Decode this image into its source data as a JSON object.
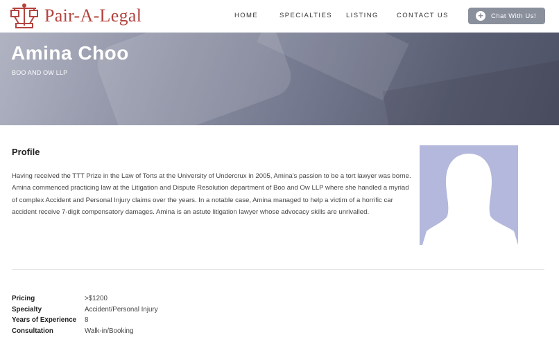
{
  "header": {
    "logo_text": "Pair-A-Legal",
    "brand_color": "#b5433f",
    "nav": [
      {
        "label": "HOME"
      },
      {
        "label": "SPECIALTIES"
      },
      {
        "label": "LISTING"
      },
      {
        "label": "CONTACT US"
      }
    ],
    "chat_button": {
      "label": "Chat With Us!",
      "icon": "plus-circle-icon",
      "color": "#8a8f9c"
    }
  },
  "hero": {
    "name": "Amina Choo",
    "firm": "BOO AND OW LLP"
  },
  "profile": {
    "heading": "Profile",
    "body": "Having received the TTT Prize in the Law of Torts at the University of Undercrux in 2005, Amina's passion to be a tort lawyer was borne. Amina commenced practicing law at the Litigation and Dispute Resolution department of Boo and Ow LLP where she handled a myriad of complex Accident and Personal Injury claims over the years. In a notable case, Amina managed to help a victim of a horrific car accident receive 7-digit compensatory damages. Amina is an astute litigation lawyer whose advocacy skills are unrivalled.",
    "avatar": "person-silhouette-icon",
    "avatar_color": "#b3b8dc"
  },
  "details": [
    {
      "label": "Pricing",
      "value": ">$1200"
    },
    {
      "label": "Specialty",
      "value": "Accident/Personal Injury"
    },
    {
      "label": "Years of Experience",
      "value": "8"
    },
    {
      "label": "Consultation",
      "value": "Walk-in/Booking"
    }
  ]
}
